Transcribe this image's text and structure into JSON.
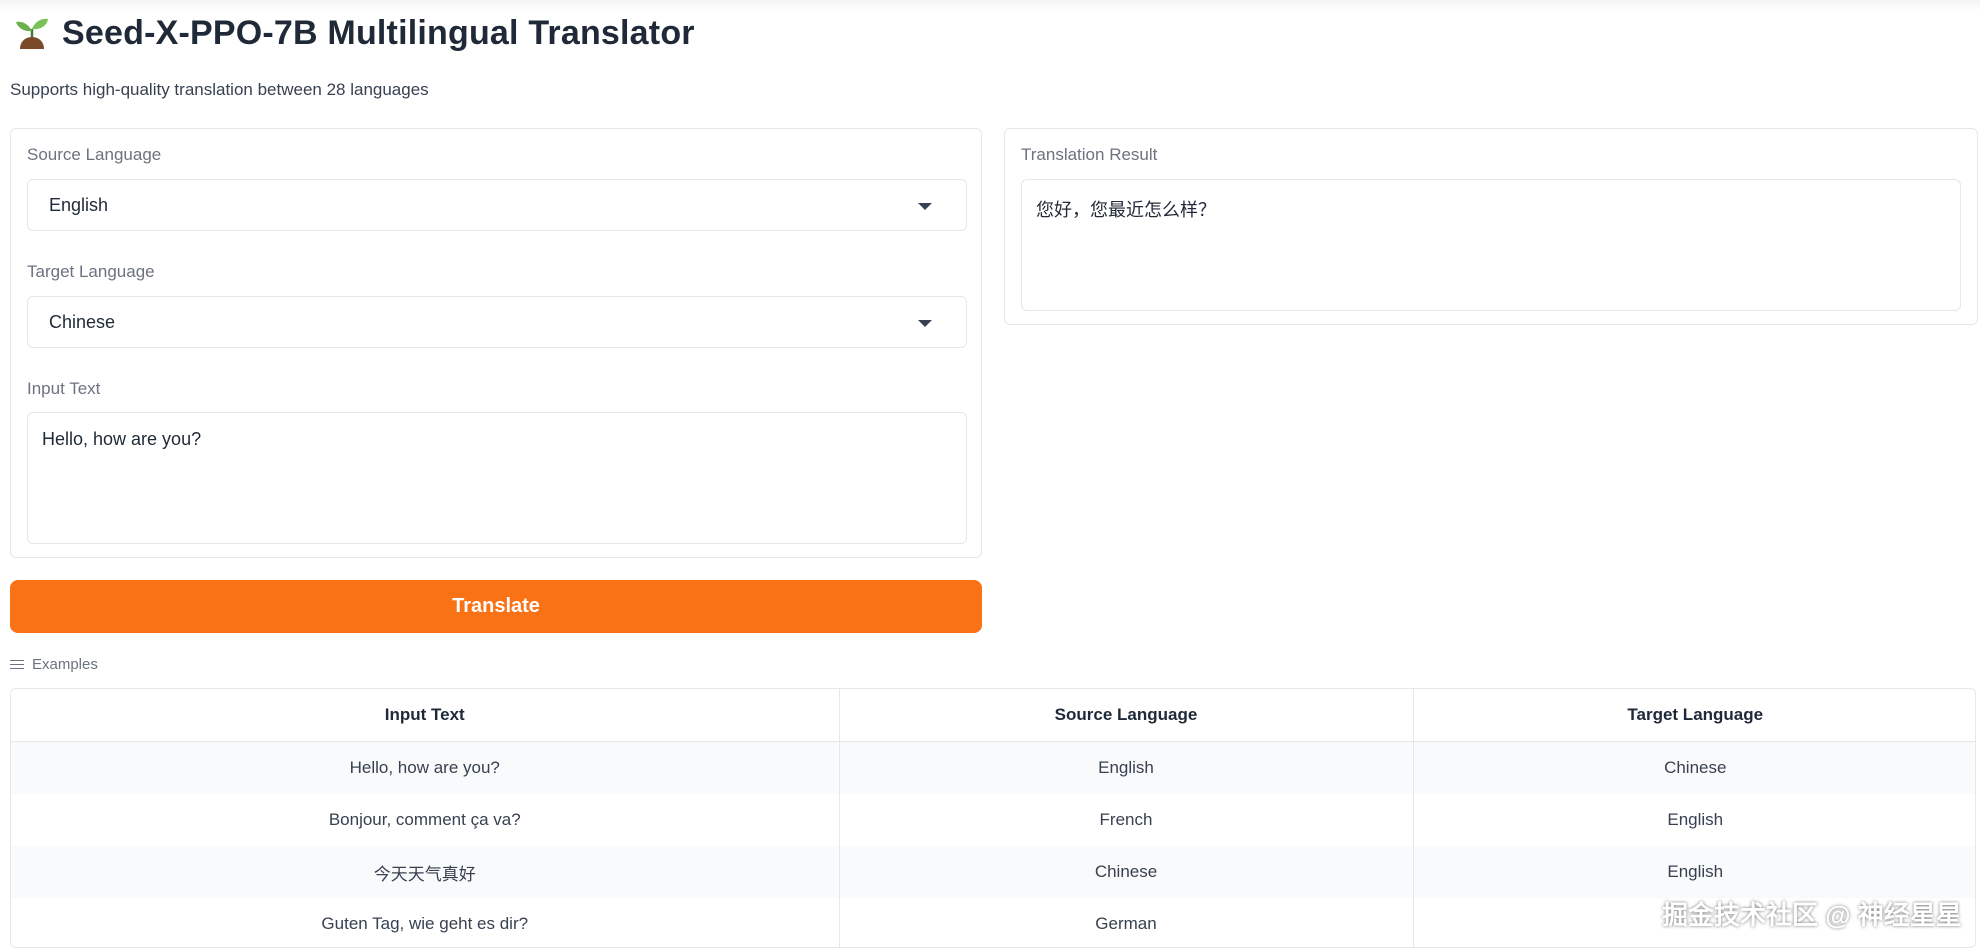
{
  "app": {
    "title": "Seed-X-PPO-7B Multilingual Translator",
    "subtitle": "Supports high-quality translation between 28 languages",
    "logo_icon": "seedling-icon"
  },
  "form": {
    "source_label": "Source Language",
    "source_value": "English",
    "target_label": "Target Language",
    "target_value": "Chinese",
    "input_label": "Input Text",
    "input_value": "Hello, how are you?",
    "translate_label": "Translate"
  },
  "result": {
    "label": "Translation Result",
    "value": "您好，您最近怎么样？"
  },
  "examples": {
    "label": "Examples",
    "icon": "list-icon",
    "headers": [
      "Input Text",
      "Source Language",
      "Target Language"
    ],
    "rows": [
      [
        "Hello, how are you?",
        "English",
        "Chinese"
      ],
      [
        "Bonjour, comment ça va?",
        "French",
        "English"
      ],
      [
        "今天天气真好",
        "Chinese",
        "English"
      ],
      [
        "Guten Tag, wie geht es dir?",
        "German",
        ""
      ]
    ]
  },
  "watermark": "掘金技术社区 @ 神经星星",
  "colors": {
    "accent": "#f97316",
    "border": "#e5e7eb",
    "muted_text": "#6b7280"
  }
}
